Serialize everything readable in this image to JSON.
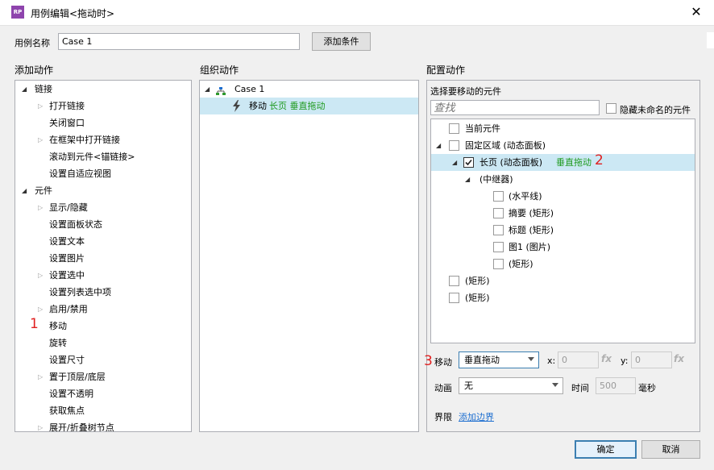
{
  "window": {
    "app_icon_text": "RP",
    "title": "用例编辑<拖动时>",
    "close_icon": "close-icon"
  },
  "case_name": {
    "label": "用例名称",
    "value": "Case 1",
    "add_condition_label": "添加条件"
  },
  "sections": {
    "add_action": "添加动作",
    "organize_action": "组织动作",
    "configure_action": "配置动作"
  },
  "add_action_tree": [
    {
      "label": "链接",
      "level": 0,
      "expander": "expanded"
    },
    {
      "label": "打开链接",
      "level": 1,
      "expander": "collapsed"
    },
    {
      "label": "关闭窗口",
      "level": 1,
      "expander": "none"
    },
    {
      "label": "在框架中打开链接",
      "level": 1,
      "expander": "collapsed"
    },
    {
      "label": "滚动到元件<锚链接>",
      "level": 1,
      "expander": "none"
    },
    {
      "label": "设置自适应视图",
      "level": 1,
      "expander": "none"
    },
    {
      "label": "元件",
      "level": 0,
      "expander": "expanded"
    },
    {
      "label": "显示/隐藏",
      "level": 1,
      "expander": "collapsed"
    },
    {
      "label": "设置面板状态",
      "level": 1,
      "expander": "none"
    },
    {
      "label": "设置文本",
      "level": 1,
      "expander": "none"
    },
    {
      "label": "设置图片",
      "level": 1,
      "expander": "none"
    },
    {
      "label": "设置选中",
      "level": 1,
      "expander": "collapsed"
    },
    {
      "label": "设置列表选中项",
      "level": 1,
      "expander": "none"
    },
    {
      "label": "启用/禁用",
      "level": 1,
      "expander": "collapsed"
    },
    {
      "label": "移动",
      "level": 1,
      "expander": "none",
      "annotation": "1"
    },
    {
      "label": "旋转",
      "level": 1,
      "expander": "none"
    },
    {
      "label": "设置尺寸",
      "level": 1,
      "expander": "none"
    },
    {
      "label": "置于顶层/底层",
      "level": 1,
      "expander": "collapsed"
    },
    {
      "label": "设置不透明",
      "level": 1,
      "expander": "none"
    },
    {
      "label": "获取焦点",
      "level": 1,
      "expander": "none"
    },
    {
      "label": "展开/折叠树节点",
      "level": 1,
      "expander": "collapsed"
    }
  ],
  "organize": {
    "case_label": "Case 1",
    "action_prefix": "移动",
    "action_target": "长页 垂直拖动"
  },
  "configure": {
    "select_label": "选择要移动的元件",
    "search_placeholder": "查找",
    "hide_unnamed_label": "隐藏未命名的元件",
    "tree": [
      {
        "label": "当前元件",
        "extra": "",
        "level": 0,
        "expander": "none",
        "checked": false
      },
      {
        "label": "固定区域 (动态面板)",
        "extra": "",
        "level": 0,
        "expander": "expanded",
        "checked": false
      },
      {
        "label": "长页 (动态面板)",
        "extra": "垂直拖动",
        "level": 1,
        "expander": "expanded",
        "checked": true,
        "selected": true,
        "annotation": "2"
      },
      {
        "label": "(中继器)",
        "extra": "",
        "level": 2,
        "expander": "expanded",
        "checkbox": false
      },
      {
        "label": "(水平线)",
        "extra": "",
        "level": 3,
        "expander": "none",
        "checked": false
      },
      {
        "label": "摘要 (矩形)",
        "extra": "",
        "level": 3,
        "expander": "none",
        "checked": false
      },
      {
        "label": "标题 (矩形)",
        "extra": "",
        "level": 3,
        "expander": "none",
        "checked": false
      },
      {
        "label": "图1 (图片)",
        "extra": "",
        "level": 3,
        "expander": "none",
        "checked": false
      },
      {
        "label": "(矩形)",
        "extra": "",
        "level": 3,
        "expander": "none",
        "checked": false
      },
      {
        "label": "(矩形)",
        "extra": "",
        "level": 0,
        "expander": "none",
        "checked": false
      },
      {
        "label": "(矩形)",
        "extra": "",
        "level": 0,
        "expander": "none",
        "checked": false
      }
    ],
    "move_annotation": "3",
    "move_label": "移动",
    "move_value": "垂直拖动",
    "x_label": "x:",
    "x_value": "0",
    "y_label": "y:",
    "y_value": "0",
    "fx_label": "fx",
    "animation_label": "动画",
    "animation_value": "无",
    "time_label": "时间",
    "time_value": "500",
    "time_unit": "毫秒",
    "boundary_label": "界限",
    "boundary_link": "添加边界"
  },
  "footer": {
    "ok_label": "确定",
    "cancel_label": "取消"
  }
}
